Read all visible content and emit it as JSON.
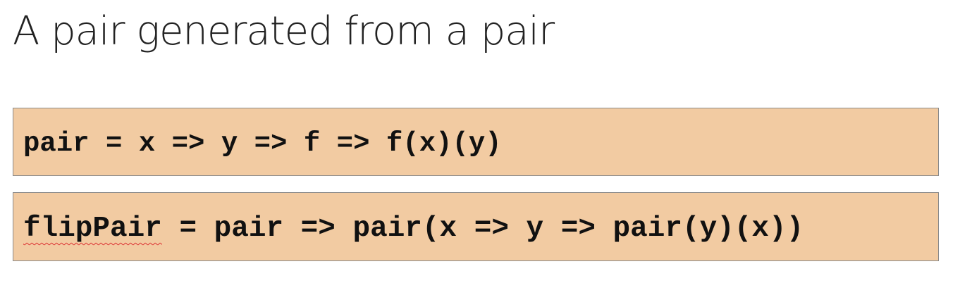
{
  "slide": {
    "title": "A pair generated from a pair"
  },
  "code_blocks": [
    {
      "text": "pair = x => y => f => f(x)(y)"
    },
    {
      "identifier": "flipPair",
      "rest": " = pair => pair(x => y => pair(y)(x))"
    }
  ],
  "colors": {
    "code_background": "#f2cba2",
    "code_border": "#8a8a8a",
    "spellcheck_underline": "#d33"
  }
}
